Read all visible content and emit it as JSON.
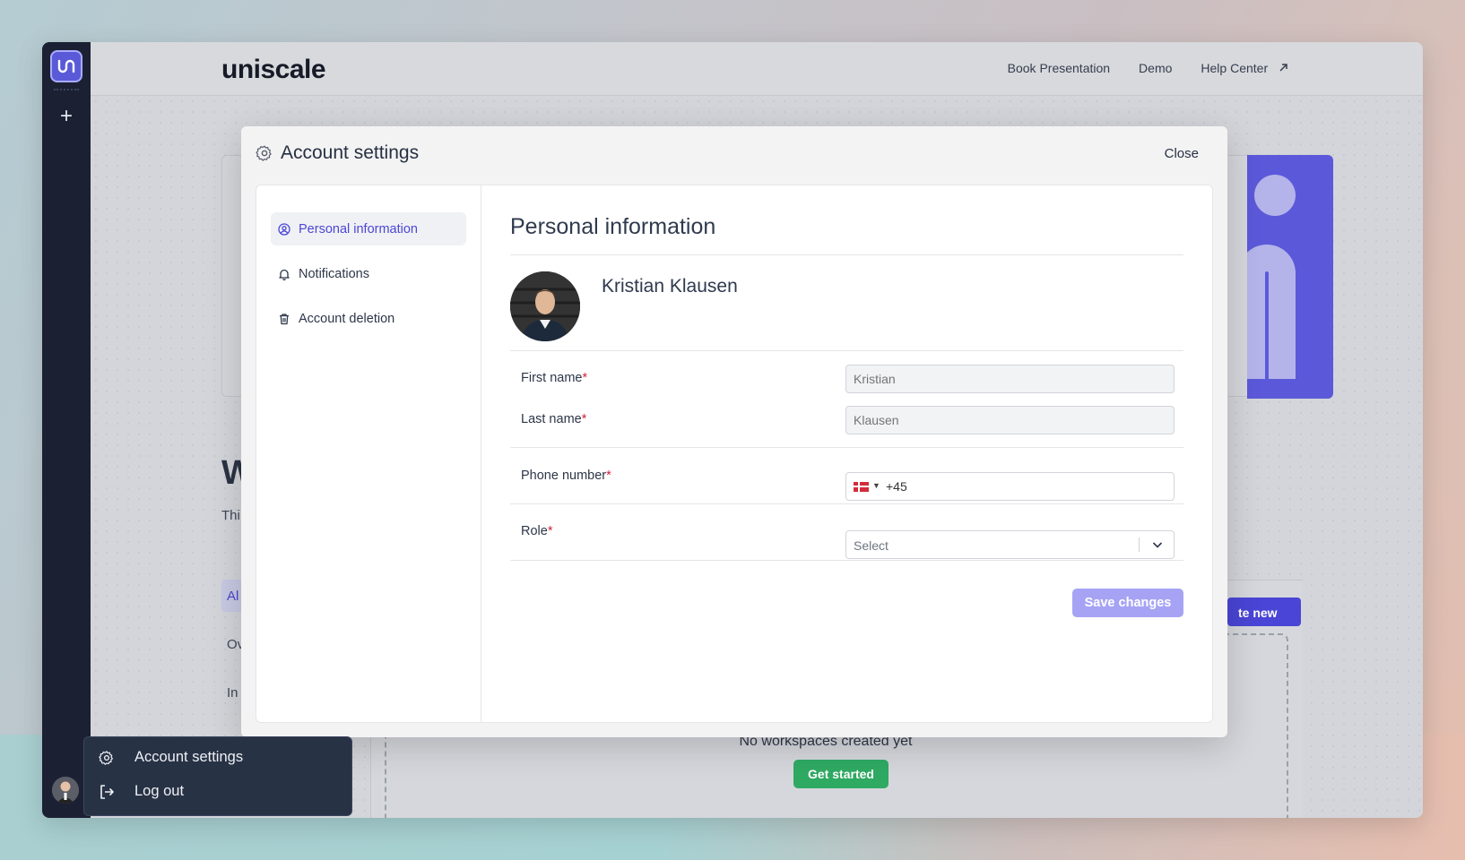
{
  "app": {
    "brand": "uniscale",
    "nav_links": [
      {
        "label": "Book Presentation"
      },
      {
        "label": "Demo"
      },
      {
        "label": "Help Center",
        "icon": "external-link-icon"
      }
    ]
  },
  "background": {
    "heading_fragment": "W",
    "subtext_fragment": "Thi",
    "tabs": [
      "Al",
      "Ov",
      "In"
    ],
    "create_new_label": "te new",
    "empty_state": "No workspaces created yet",
    "get_started_label": "Get started"
  },
  "modal": {
    "title": "Account settings",
    "close_label": "Close",
    "nav": [
      {
        "label": "Personal information",
        "icon": "user-circle-icon",
        "active": true
      },
      {
        "label": "Notifications",
        "icon": "bell-icon",
        "active": false
      },
      {
        "label": "Account deletion",
        "icon": "trash-icon",
        "active": false
      }
    ],
    "section_title": "Personal information",
    "profile_name": "Kristian Klausen",
    "fields": {
      "first_name": {
        "label": "First name",
        "required_mark": "*",
        "placeholder": "Kristian"
      },
      "last_name": {
        "label": "Last name",
        "required_mark": "*",
        "placeholder": "Klausen"
      },
      "phone": {
        "label": "Phone number",
        "required_mark": "*",
        "country": "DK",
        "value": "+45"
      },
      "role": {
        "label": "Role",
        "required_mark": "*",
        "value": "Select"
      }
    },
    "save_label": "Save changes"
  },
  "popover": {
    "items": [
      {
        "label": "Account settings",
        "icon": "gear-icon"
      },
      {
        "label": "Log out",
        "icon": "logout-icon"
      }
    ]
  },
  "colors": {
    "accent": "#4c46d8",
    "rail": "#1b2133",
    "save_button": "#a6a3f5",
    "get_started": "#2faa63",
    "required": "#d1243e"
  }
}
